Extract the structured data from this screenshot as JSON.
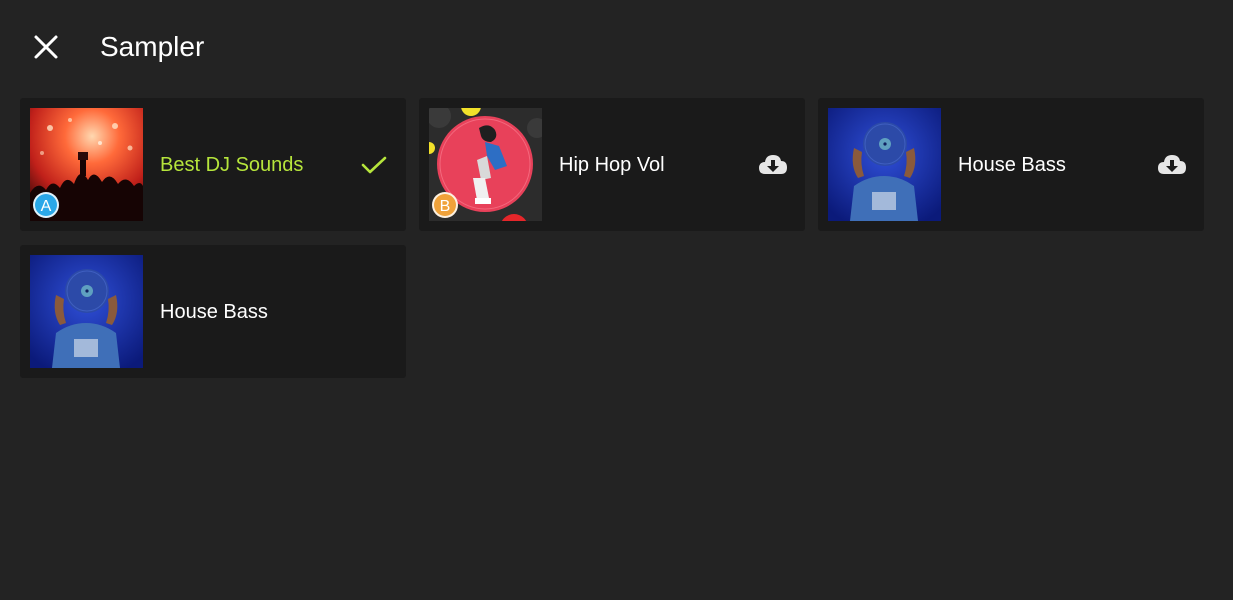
{
  "header": {
    "title": "Sampler",
    "close_icon": "close-icon"
  },
  "colors": {
    "background": "#232323",
    "card": "#1a1a1a",
    "active_accent": "#b6e53c",
    "badge_a": "#2aa7e8",
    "badge_b": "#f0a23a"
  },
  "samplers": [
    {
      "label": "Best DJ Sounds",
      "badge": "A",
      "status": "selected",
      "status_icon": "checkmark-icon",
      "active": true
    },
    {
      "label": "Hip Hop Vol",
      "badge": "B",
      "status": "download",
      "status_icon": "cloud-download-icon",
      "active": false
    },
    {
      "label": "House Bass",
      "badge": "",
      "status": "download",
      "status_icon": "cloud-download-icon",
      "active": false
    },
    {
      "label": "House Bass",
      "badge": "",
      "status": "none",
      "status_icon": "",
      "active": false
    }
  ]
}
